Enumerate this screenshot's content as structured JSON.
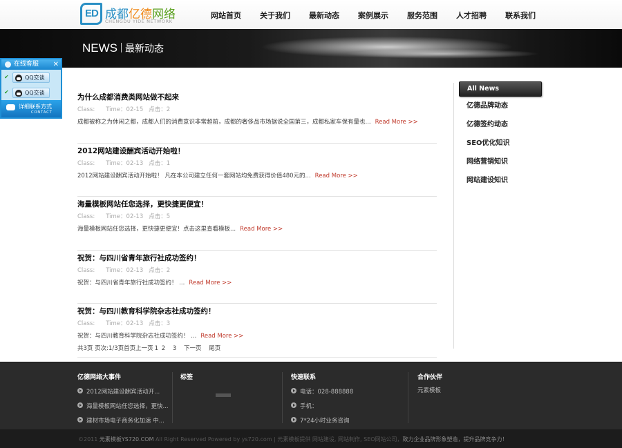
{
  "header": {
    "logo_cn_1": "成都",
    "logo_cn_2": "亿德",
    "logo_cn_3": "网络",
    "logo_en": "CHENGDU YIDE NETWORK",
    "logo_mark": "ED",
    "nav": [
      "网站首页",
      "关于我们",
      "最新动态",
      "案例展示",
      "服务范围",
      "人才招聘",
      "联系我们"
    ]
  },
  "banner": {
    "en": "NEWS",
    "cn": "最新动态"
  },
  "service": {
    "title": "在线客服",
    "close": "✕",
    "qq": [
      "QQ交谈",
      "QQ交谈"
    ],
    "foot_cn": "详细联系方式",
    "foot_en": "CONTACT"
  },
  "news": [
    {
      "title": "为什么成都消费类网站做不起来",
      "class_label": "Class:",
      "time": "Time：02-15",
      "clicks": "点击：2",
      "desc": "成都被称之为休闲之都，成都人们的消费意识非常超前，成都的奢侈品市场据说全国第三，成都私家车保有量也...",
      "more": "Read More >>"
    },
    {
      "title": "2012网站建设酬宾活动开始啦！",
      "class_label": "Class:",
      "time": "Time：02-13",
      "clicks": "点击：1",
      "desc": "2012网站建设酬宾活动开始啦！ 凡在本公司建立任何一套网站均免费获得价值480元的...",
      "more": "Read More >>"
    },
    {
      "title": "海量模板网站任您选择，更快捷更便宜！",
      "class_label": "Class:",
      "time": "Time：02-13",
      "clicks": "点击：5",
      "desc": "海量模板网站任您选择，更快捷更便宜！点击这里查看模板...",
      "more": "Read More >>"
    },
    {
      "title": "祝贺：与四川省青年旅行社成功签约！",
      "class_label": "Class:",
      "time": "Time：02-13",
      "clicks": "点击：2",
      "desc": "祝贺：与四川省青年旅行社成功签约！ ...",
      "more": "Read More >>"
    },
    {
      "title": "祝贺：与四川教育科学院杂志社成功签约！",
      "class_label": "Class:",
      "time": "Time：02-13",
      "clicks": "点击：3",
      "desc": "祝贺：与四川教育科学院杂志社成功签约！ ...",
      "more": "Read More >>"
    }
  ],
  "pager": {
    "summary": "共3页 页次:1/3页首页上一页",
    "p1": "1",
    "p2": "2",
    "p3": "3",
    "next": "下一页",
    "last": "尾页"
  },
  "sidebar": {
    "active": "All News",
    "items": [
      "亿德品牌动态",
      "亿德签约动态",
      "SEO优化知识",
      "网络营销知识",
      "网站建设知识"
    ]
  },
  "footer": {
    "events_title": "亿德网络大事件",
    "events": [
      "2012网站建设酬宾活动开...",
      "海量模板网站任您选择，更快...",
      "建材市场电子商务化加速 中..."
    ],
    "tags_title": "标签",
    "contact_title": "快速联系",
    "contact": [
      "电话：028-888888",
      "手机：",
      "7*24小时业务咨询"
    ],
    "partners_title": "合作伙伴",
    "partners": [
      "元素模板"
    ]
  },
  "copyright": {
    "prefix": "©2011 ",
    "brand": "元素模板YS720.COM",
    "middle": " All Right Reserved Powered by ys720.com | 元素模板提供 网站建设, 网站制作, SEO网站公司，",
    "slogan": "致力企业品牌形象塑造，提升品牌竞争力！"
  }
}
